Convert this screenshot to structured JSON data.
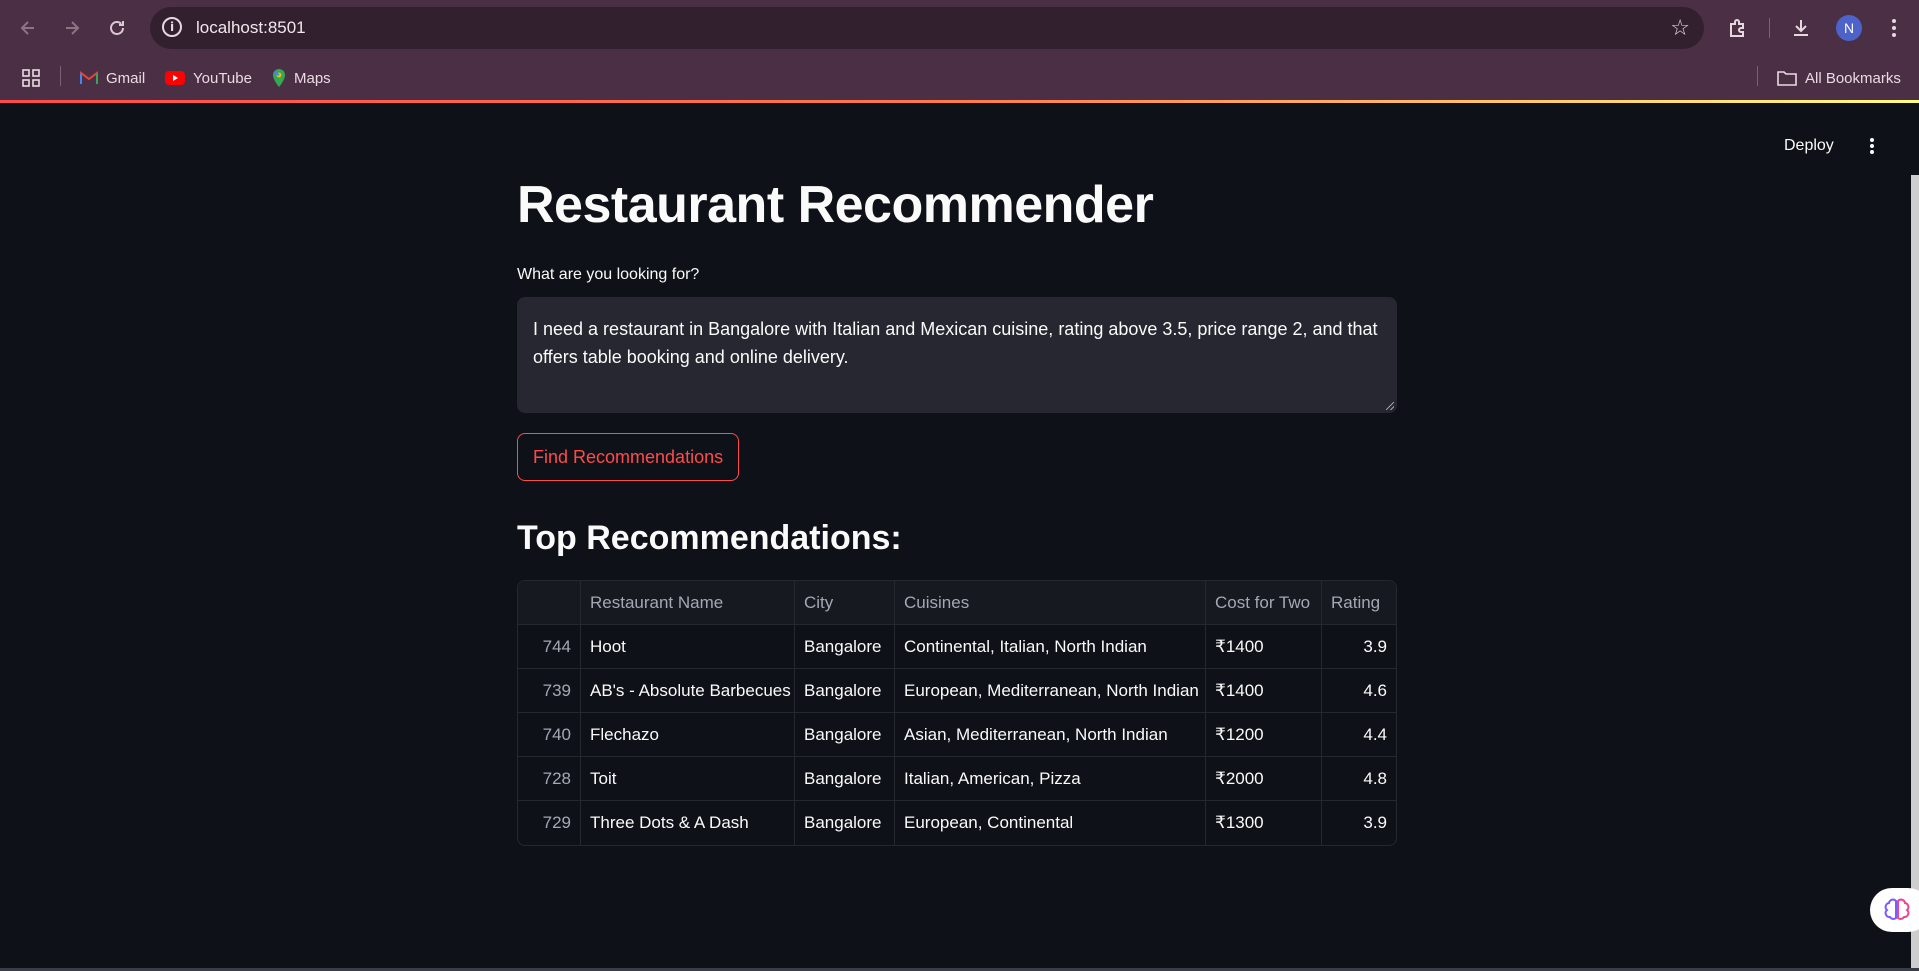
{
  "browser": {
    "url": "localhost:8501",
    "profile_initial": "N",
    "bookmarks": [
      {
        "label": "Gmail",
        "icon": "gmail-icon"
      },
      {
        "label": "YouTube",
        "icon": "youtube-icon"
      },
      {
        "label": "Maps",
        "icon": "maps-icon"
      }
    ],
    "all_bookmarks_label": "All Bookmarks"
  },
  "app": {
    "deploy_label": "Deploy",
    "title": "Restaurant Recommender",
    "query_label": "What are you looking for?",
    "query_value": "I need a restaurant in Bangalore with Italian and Mexican cuisine, rating above 3.5, price range 2, and that offers table booking and online delivery.",
    "submit_label": "Find Recommendations",
    "results_heading": "Top Recommendations:",
    "accent_color": "#ff4b4b",
    "table": {
      "columns": [
        "",
        "Restaurant Name",
        "City",
        "Cuisines",
        "Cost for Two",
        "Rating"
      ],
      "rows": [
        {
          "index": "744",
          "name": "Hoot",
          "city": "Bangalore",
          "cuisines": "Continental, Italian, North Indian",
          "cost": "₹1400",
          "rating": "3.9"
        },
        {
          "index": "739",
          "name": "AB's - Absolute Barbecues",
          "city": "Bangalore",
          "cuisines": "European, Mediterranean, North Indian",
          "cost": "₹1400",
          "rating": "4.6"
        },
        {
          "index": "740",
          "name": "Flechazo",
          "city": "Bangalore",
          "cuisines": "Asian, Mediterranean, North Indian",
          "cost": "₹1200",
          "rating": "4.4"
        },
        {
          "index": "728",
          "name": "Toit",
          "city": "Bangalore",
          "cuisines": "Italian, American, Pizza",
          "cost": "₹2000",
          "rating": "4.8"
        },
        {
          "index": "729",
          "name": "Three Dots & A Dash",
          "city": "Bangalore",
          "cuisines": "European, Continental",
          "cost": "₹1300",
          "rating": "3.9"
        }
      ]
    }
  }
}
